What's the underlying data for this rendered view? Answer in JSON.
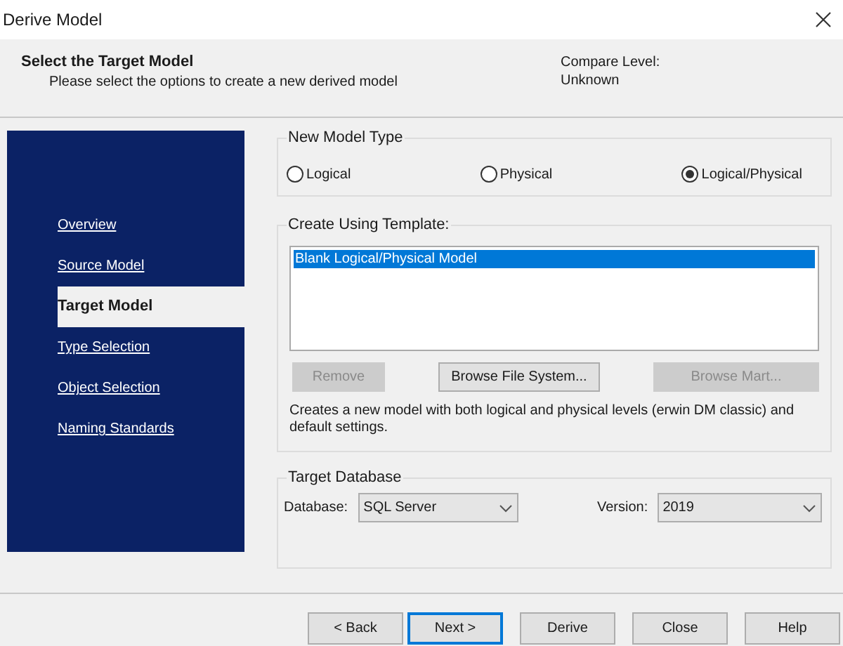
{
  "window": {
    "title": "Derive Model"
  },
  "header": {
    "title": "Select the Target Model",
    "subtitle": "Please select the options to create a new derived model",
    "compare_label": "Compare Level:",
    "compare_value": "Unknown"
  },
  "nav": [
    {
      "label": "Overview",
      "selected": false
    },
    {
      "label": "Source Model",
      "selected": false
    },
    {
      "label": "Target Model",
      "selected": true
    },
    {
      "label": "Type Selection",
      "selected": false
    },
    {
      "label": "Object Selection",
      "selected": false
    },
    {
      "label": "Naming Standards",
      "selected": false
    }
  ],
  "model_type": {
    "legend": "New Model Type",
    "options": [
      {
        "label": "Logical",
        "selected": false
      },
      {
        "label": "Physical",
        "selected": false
      },
      {
        "label": "Logical/Physical",
        "selected": true
      }
    ]
  },
  "template": {
    "legend": "Create Using Template:",
    "items": [
      {
        "label": "Blank Logical/Physical Model",
        "selected": true
      }
    ],
    "buttons": [
      {
        "label": "Remove",
        "disabled": true
      },
      {
        "label": "Browse File System...",
        "disabled": false
      },
      {
        "label": "Browse Mart...",
        "disabled": true
      }
    ],
    "description": "Creates a new model with both logical and physical levels (erwin DM classic) and default settings."
  },
  "target_database": {
    "legend": "Target Database",
    "database_label": "Database:",
    "database_value": "SQL Server",
    "version_label": "Version:",
    "version_value": "2019"
  },
  "footer_buttons": [
    {
      "label": "< Back",
      "default": false
    },
    {
      "label": "Next >",
      "default": true
    },
    {
      "label": "Derive",
      "default": false
    },
    {
      "label": "Close",
      "default": false
    },
    {
      "label": "Help",
      "default": false
    }
  ]
}
